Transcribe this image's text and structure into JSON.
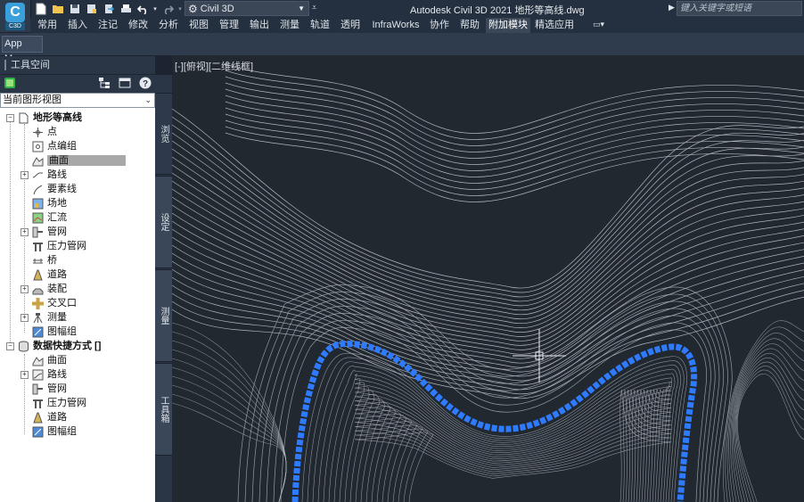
{
  "titlebar": {
    "logo_text": "C",
    "logo_sub": "C3D",
    "workspace": "Civil 3D",
    "app_title": "Autodesk Civil 3D 2021    地形等高线.dwg",
    "search_placeholder": "键入关键字或短语"
  },
  "ribbon": {
    "tabs": [
      {
        "label": "常用"
      },
      {
        "label": "插入"
      },
      {
        "label": "注记"
      },
      {
        "label": "修改"
      },
      {
        "label": "分析"
      },
      {
        "label": "视图"
      },
      {
        "label": "管理"
      },
      {
        "label": "输出"
      },
      {
        "label": "测量"
      },
      {
        "label": "轨道"
      },
      {
        "label": "透明"
      },
      {
        "label": "InfraWorks"
      },
      {
        "label": "协作"
      },
      {
        "label": "帮助"
      },
      {
        "label": "附加模块"
      },
      {
        "label": "精选应用"
      }
    ],
    "active_tab": "附加模块",
    "panel_button": "App Ma..."
  },
  "toolspace": {
    "title": "工具空间",
    "view_selector": "当前图形视图",
    "tree": {
      "root": "地形等高线",
      "items": [
        {
          "label": "点"
        },
        {
          "label": "点编组"
        },
        {
          "label": "曲面"
        },
        {
          "label": "路线"
        },
        {
          "label": "要素线"
        },
        {
          "label": "场地"
        },
        {
          "label": "汇流"
        },
        {
          "label": "管网"
        },
        {
          "label": "压力管网"
        },
        {
          "label": "桥"
        },
        {
          "label": "道路"
        },
        {
          "label": "装配"
        },
        {
          "label": "交叉口"
        },
        {
          "label": "测量"
        },
        {
          "label": "图幅组"
        }
      ],
      "shortcuts_root": "数据快捷方式 []",
      "shortcut_items": [
        {
          "label": "曲面"
        },
        {
          "label": "路线"
        },
        {
          "label": "管网"
        },
        {
          "label": "压力管网"
        },
        {
          "label": "道路"
        },
        {
          "label": "图幅组"
        }
      ]
    },
    "side_tabs": [
      "浏览",
      "设定",
      "测量",
      "工具箱"
    ]
  },
  "viewport": {
    "label": "[-][俯视][二维线框]"
  },
  "colors": {
    "accent_blue": "#1f6fff",
    "title_bg": "#24303f",
    "viewport_bg": "#212830",
    "selected_bg": "#a8a8a8"
  }
}
